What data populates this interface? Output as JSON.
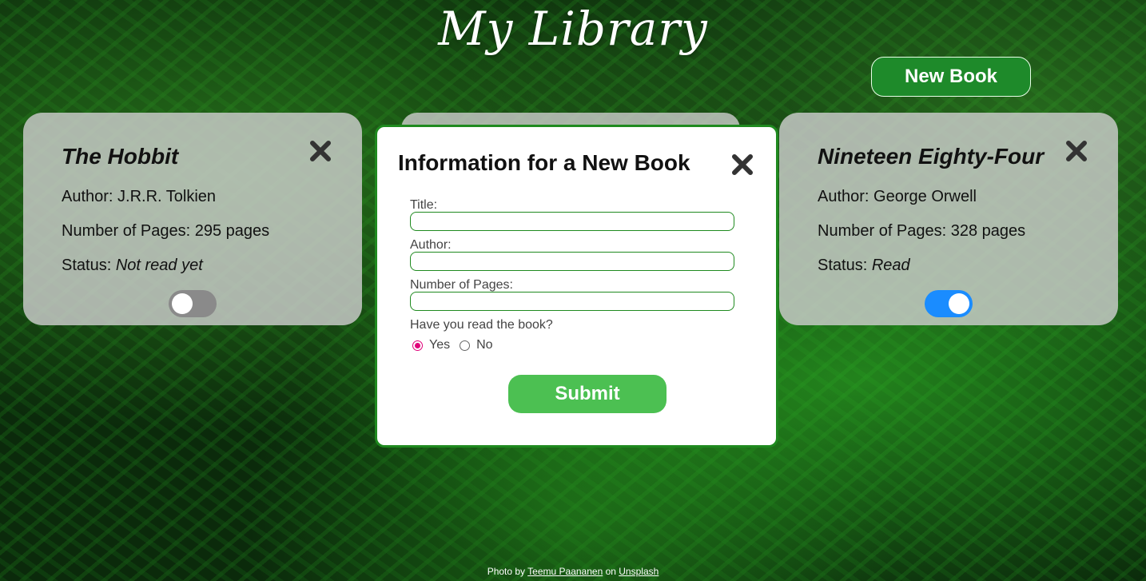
{
  "header": {
    "title": "My Library",
    "new_book_label": "New Book"
  },
  "books": [
    {
      "title": "The Hobbit",
      "author_label": "Author: ",
      "author": "J.R.R. Tolkien",
      "pages_label": "Number of Pages: ",
      "pages": "295 pages",
      "status_label": "Status: ",
      "status": "Not read yet",
      "read": false
    },
    {
      "title": "Nineteen Eighty-Four",
      "author_label": "Author: ",
      "author": "George Orwell",
      "pages_label": "Number of Pages: ",
      "pages": "328 pages",
      "status_label": "Status: ",
      "status": "Read",
      "read": true
    }
  ],
  "modal": {
    "title": "Information for a New Book",
    "fields": [
      {
        "label": "Title:",
        "value": ""
      },
      {
        "label": "Author:",
        "value": ""
      },
      {
        "label": "Number of Pages:",
        "value": ""
      }
    ],
    "read_question": "Have you read the book?",
    "options": [
      "Yes",
      "No"
    ],
    "selected_option": "Yes",
    "submit_label": "Submit"
  },
  "footer": {
    "prefix": "Photo by ",
    "author_link": "Teemu Paananen",
    "middle": " on ",
    "site_link": "Unsplash"
  },
  "colors": {
    "accent_green": "#1f8a1f",
    "submit_green": "#4cc052",
    "toggle_on": "#1a8cff",
    "toggle_off": "#8a8a8a",
    "radio_checked": "#e0007a"
  }
}
